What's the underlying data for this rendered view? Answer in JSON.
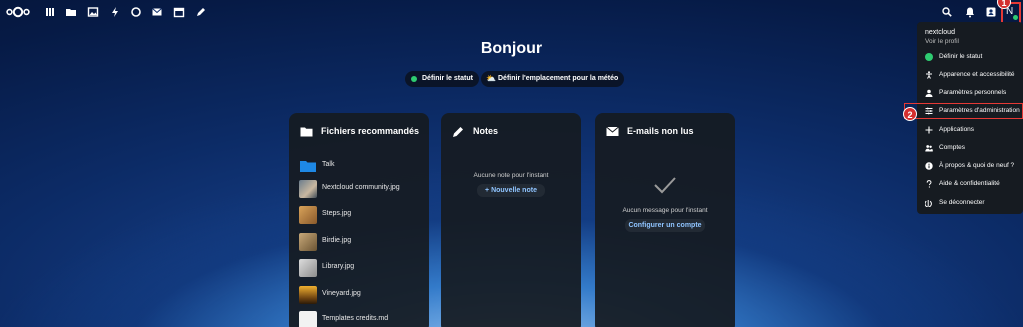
{
  "header": {
    "nav_icons": [
      "dashboard-icon",
      "files-icon",
      "photos-icon",
      "activity-icon",
      "search-talk-icon",
      "mail-icon",
      "calendar-icon",
      "notes-icon"
    ],
    "right_icons": [
      "search-icon",
      "notifications-icon",
      "contacts-icon"
    ],
    "avatar_initial": "N",
    "badge_1": "1",
    "badge_2": "2"
  },
  "greeting": "Bonjour",
  "actions": {
    "status": "Définir le statut",
    "weather": "Définir l'emplacement pour la météo"
  },
  "widgets": {
    "files": {
      "title": "Fichiers recommandés",
      "items": [
        {
          "name": "Talk"
        },
        {
          "name": "Nextcloud community.jpg"
        },
        {
          "name": "Steps.jpg"
        },
        {
          "name": "Birdie.jpg"
        },
        {
          "name": "Library.jpg"
        },
        {
          "name": "Vineyard.jpg"
        },
        {
          "name": "Templates credits.md"
        }
      ]
    },
    "notes": {
      "title": "Notes",
      "empty": "Aucune note pour l'instant",
      "button": "Nouvelle note",
      "button_prefix": "+"
    },
    "mail": {
      "title": "E-mails non lus",
      "empty": "Aucun message pour l'instant",
      "button": "Configurer un compte"
    }
  },
  "menu": {
    "user": "nextcloud",
    "profile": "Voir le profil",
    "items": [
      {
        "label": "Définir le statut"
      },
      {
        "label": "Apparence et accessibilité"
      },
      {
        "label": "Paramètres personnels"
      },
      {
        "label": "Paramètres d'administration"
      },
      {
        "label": "Applications"
      },
      {
        "label": "Comptes"
      },
      {
        "label": "À propos & quoi de neuf ?"
      },
      {
        "label": "Aide & confidentialité"
      },
      {
        "label": "Se déconnecter"
      }
    ]
  },
  "colors": {
    "accent": "#8fc4ff",
    "status_online": "#2ecc71",
    "highlight": "#e53935"
  }
}
